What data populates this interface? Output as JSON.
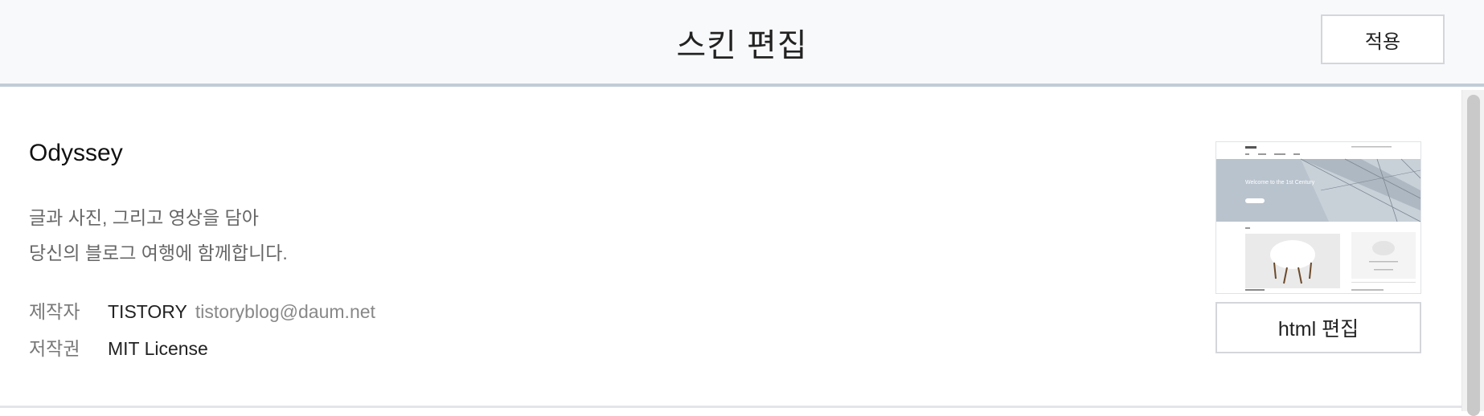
{
  "header": {
    "title": "스킨 편집",
    "apply_label": "적용"
  },
  "skin": {
    "name": "Odyssey",
    "description_line1": "글과 사진, 그리고 영상을 담아",
    "description_line2": "당신의 블로그 여행에 함께합니다.",
    "author_label": "제작자",
    "author_name": "TISTORY",
    "author_email": "tistoryblog@daum.net",
    "license_label": "저작권",
    "license_value": "MIT License",
    "thumbnail_banner_text": "Welcome to the 1st Century",
    "edit_html_label": "html 편집"
  },
  "colors": {
    "header_bg": "#f8f9fb",
    "header_border": "#c2ccd6",
    "banner": "#b9c3cd"
  },
  "icons": {
    "thumbnail": "skin-preview-image"
  }
}
